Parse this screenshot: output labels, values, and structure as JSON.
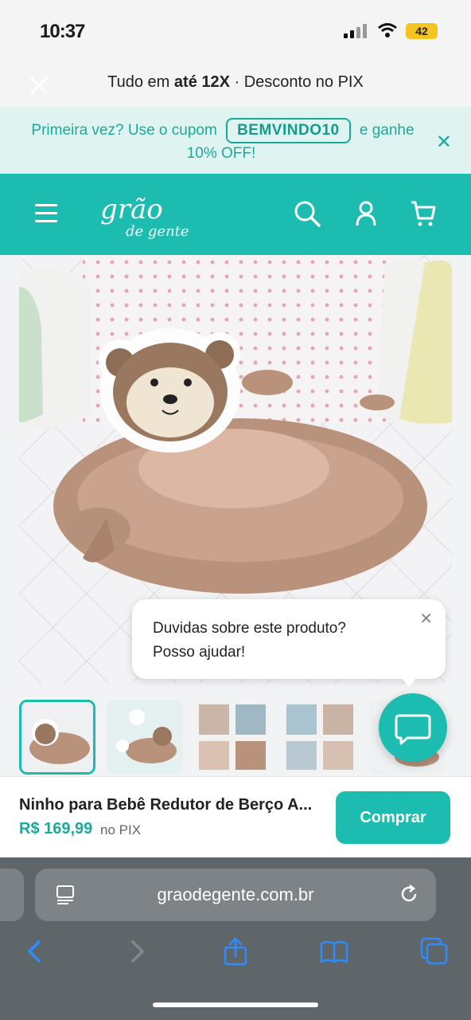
{
  "status_bar": {
    "time": "10:37",
    "battery": "42"
  },
  "promo": {
    "text_prefix": "Tudo em ",
    "text_bold": "até 12X",
    "text_suffix": " · Desconto no PIX"
  },
  "coupon": {
    "prefix": "Primeira vez? Use o cupom",
    "code": "BEMVINDO10",
    "suffix": "e ganhe",
    "line2": "10% OFF!"
  },
  "header": {
    "logo_top": "grão",
    "logo_bottom": "de gente"
  },
  "chat": {
    "line1": "Duvidas sobre este produto?",
    "line2": "Posso ajudar!"
  },
  "product": {
    "name": "Ninho para Bebê Redutor de Berço A...",
    "price": "R$ 169,99",
    "price_suffix": "no PIX",
    "buy_label": "Comprar"
  },
  "browser": {
    "domain": "graodegente.com.br"
  },
  "colors": {
    "brand": "#1cbcb0",
    "coupon_bg": "#dff4f0",
    "price": "#1aa99a"
  }
}
